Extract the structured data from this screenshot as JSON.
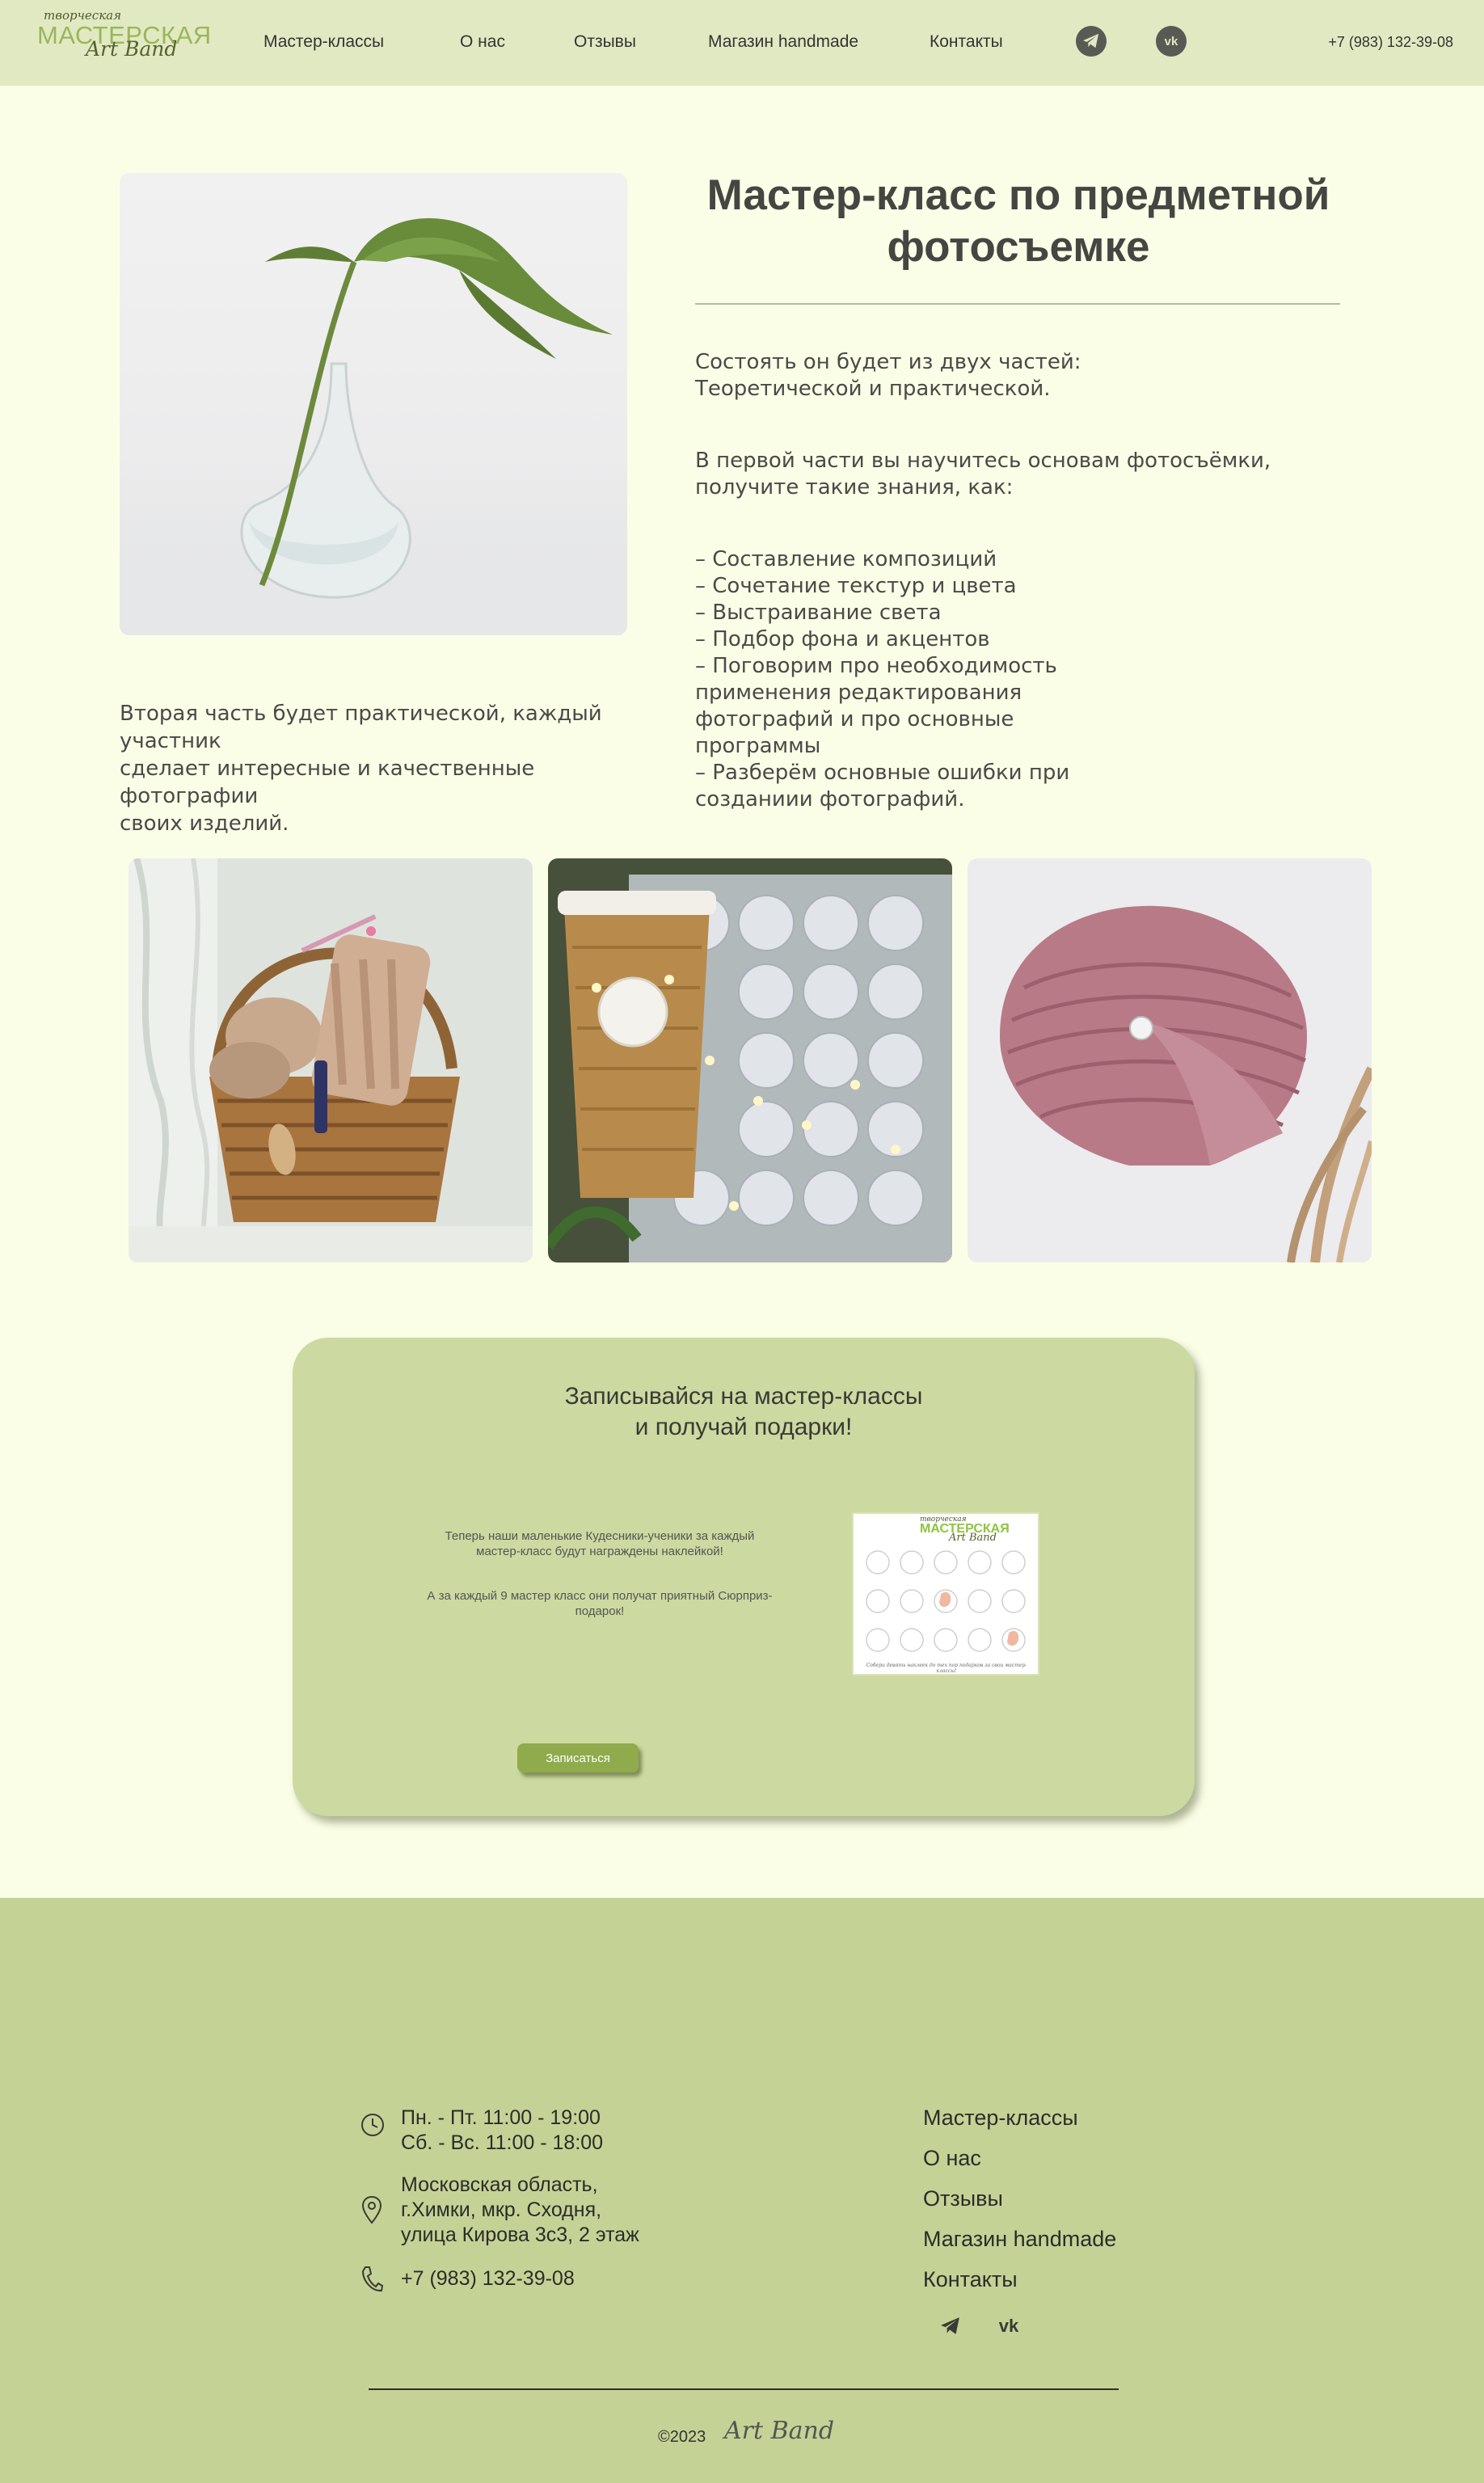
{
  "header": {
    "logo": {
      "line1": "творческая",
      "line2": "МАСТЕРСКАЯ",
      "line3": "Art Band"
    },
    "nav": [
      "Мастер-классы",
      "О нас",
      "Отзывы",
      "Магазин handmade",
      "Контакты"
    ],
    "social": [
      "telegram-icon",
      "vk-icon"
    ],
    "phone": "+7 (983) 132-39-08"
  },
  "main": {
    "title": "Мастер-класс по предметной фотосъемке",
    "para1": [
      "Состоять он будет из двух частей:",
      "Теоретической и практической."
    ],
    "para2": [
      "В первой части вы научитесь основам фотосъёмки,",
      "получите такие знания, как:"
    ],
    "list": [
      "– Составление композиций",
      "– Сочетание текстур и цвета",
      "– Выстраивание света",
      "– Подбор фона и акцентов",
      "– Поговорим про необходимость",
      "применения редактирования",
      "фотографий и про основные",
      "программы",
      "– Разберём основные ошибки при",
      "созданиии фотографий."
    ],
    "second_part": [
      "Вторая часть будет практической, каждый",
      "участник",
      "сделает интересные и качественные фотографии",
      "своих изделий."
    ]
  },
  "promo": {
    "title_line1": "Записывайся на мастер-классы",
    "title_line2": "и получай подарки!",
    "text1": "Теперь наши маленькие Кудесники-ученики за каждый мастер-класс будут награждены наклейкой!",
    "text2": "А за каждый 9 мастер класс они получат приятный Сюрприз-подарок!",
    "sticker_logo": {
      "line1": "творческая",
      "line2": "МАСТЕРСКАЯ",
      "line3": "Art Band"
    },
    "sticker_caption": "Собери девять наклеек до тех пор подарков за свои мастер-классы!",
    "button": "Записаться"
  },
  "footer": {
    "hours": [
      "Пн. - Пт. 11:00 - 19:00",
      "Сб. - Вс. 11:00 - 18:00"
    ],
    "address": [
      "Московская область,",
      "г.Химки, мкр. Сходня,",
      "улица Кирова 3с3, 2 этаж"
    ],
    "phone": "+7 (983) 132-39-08",
    "links": [
      "Мастер-классы",
      "О нас",
      "Отзывы",
      "Магазин handmade",
      "Контакты"
    ],
    "copyright": "©2023",
    "brand": "Art Band"
  },
  "colors": {
    "header_bg": "#e1e9c2",
    "page_bg": "#fbfee6",
    "accent": "#8fab4c",
    "promo_bg": "#ccd9a0",
    "footer_bg": "#c5d295"
  }
}
